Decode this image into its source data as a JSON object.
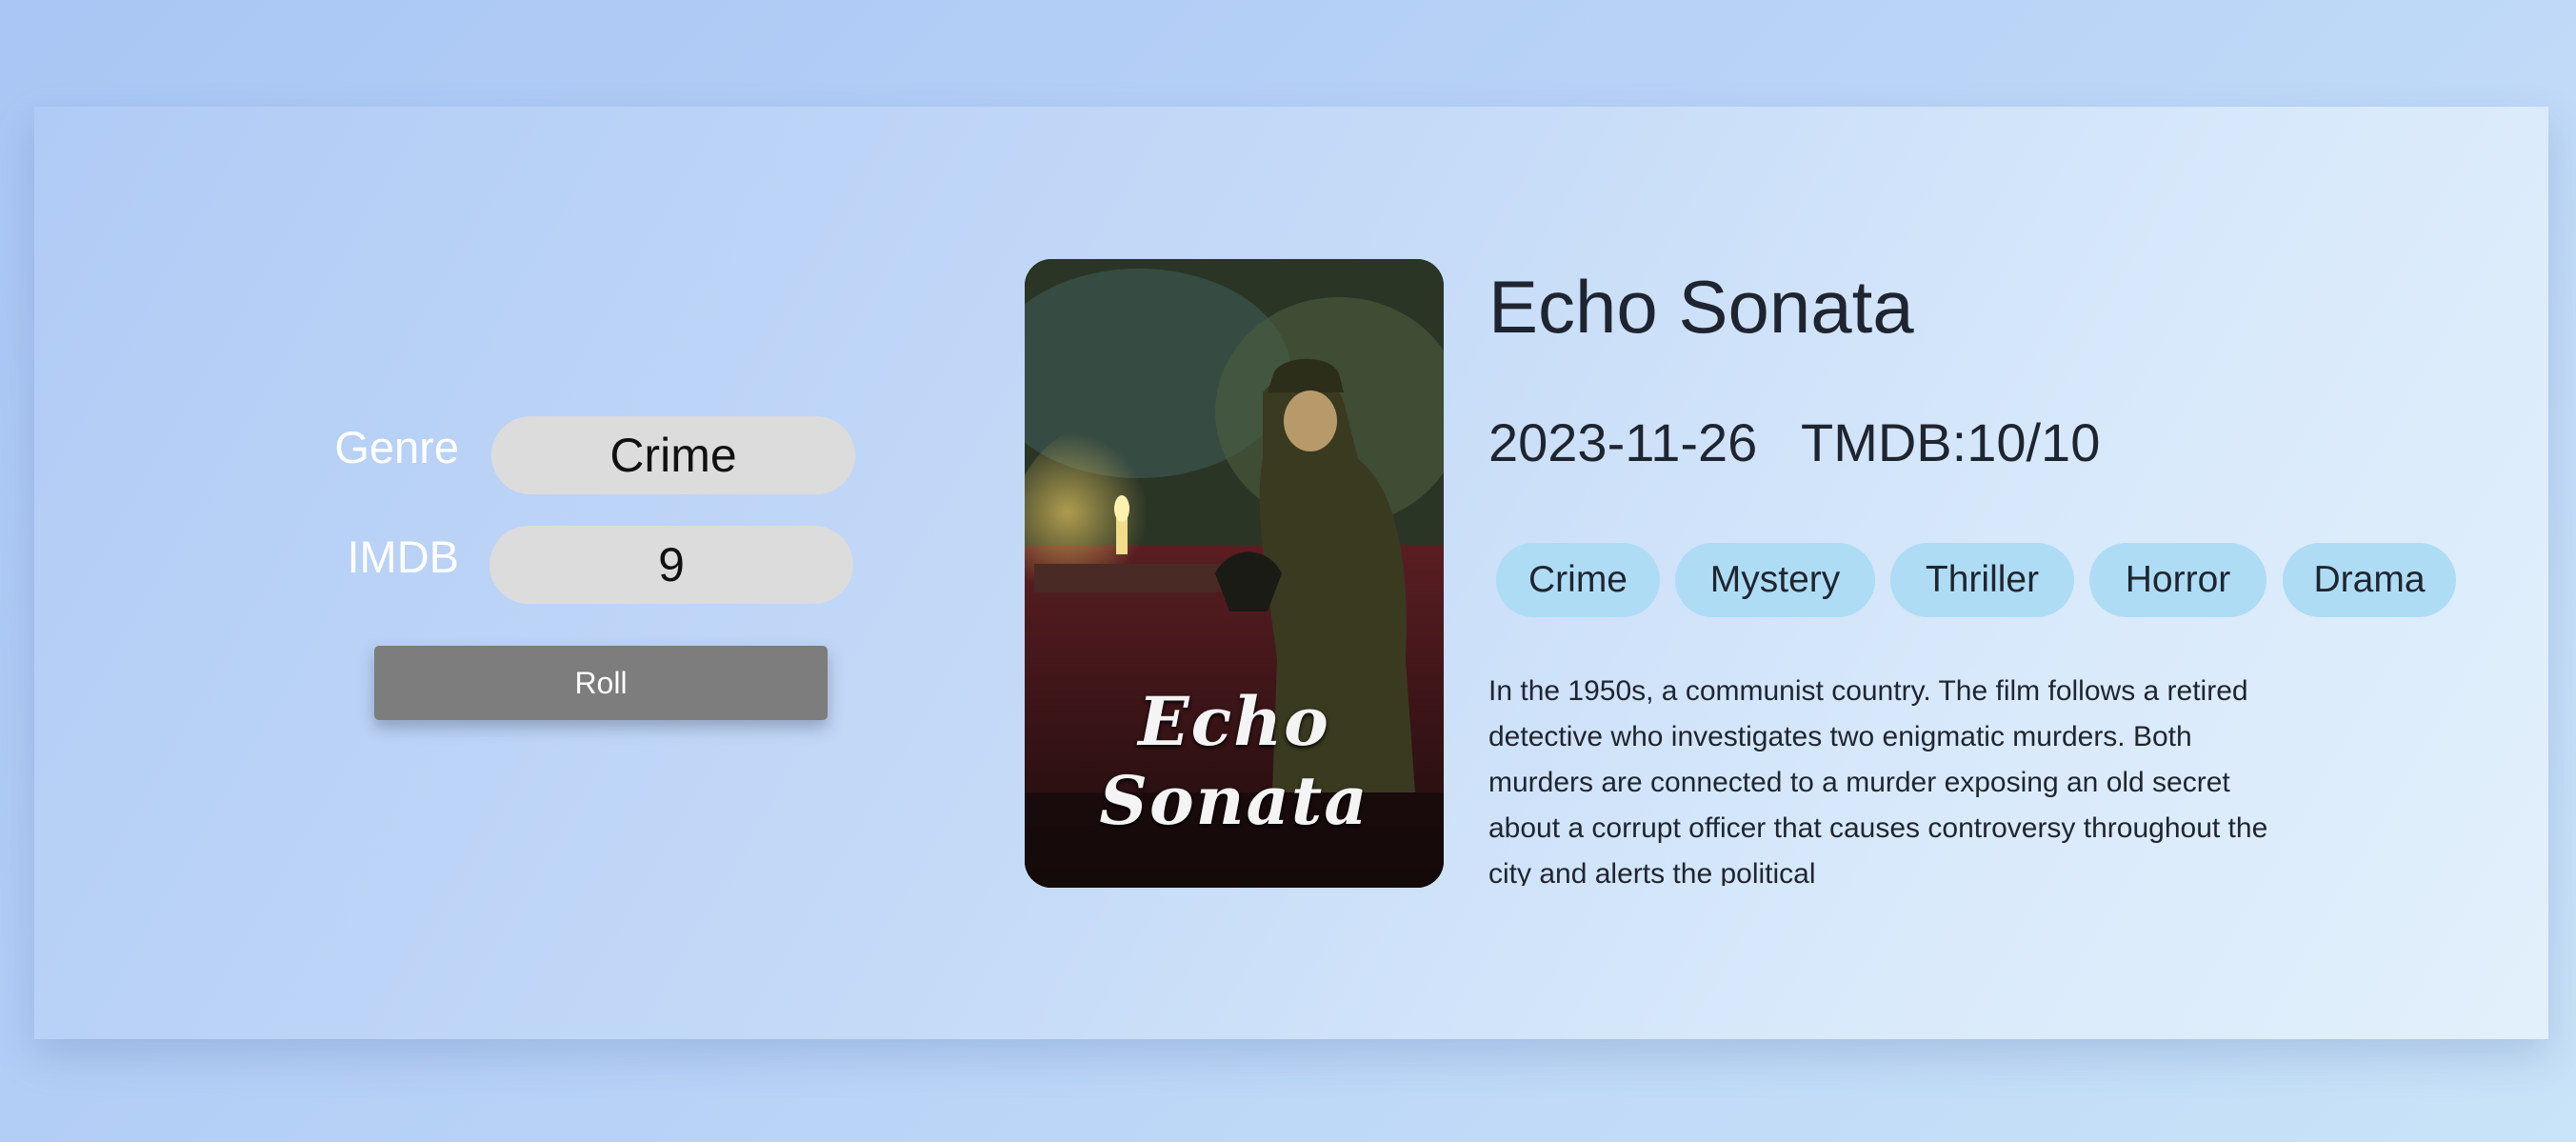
{
  "controls": {
    "genre_label": "Genre",
    "genre_value": "Crime",
    "imdb_label": "IMDB",
    "imdb_value": "9",
    "roll_label": "Roll"
  },
  "movie": {
    "poster_title": "Echo Sonata",
    "title": "Echo Sonata",
    "release_date": "2023-11-26",
    "rating": "TMDB:10/10",
    "genres": [
      "Crime",
      "Mystery",
      "Thriller",
      "Horror",
      "Drama"
    ],
    "overview": "In the 1950s, a communist country. The film follows a retired detective who investigates two enigmatic murders. Both murders are connected to a murder exposing an old secret about a corrupt officer that causes controversy throughout the city and alerts the political"
  }
}
